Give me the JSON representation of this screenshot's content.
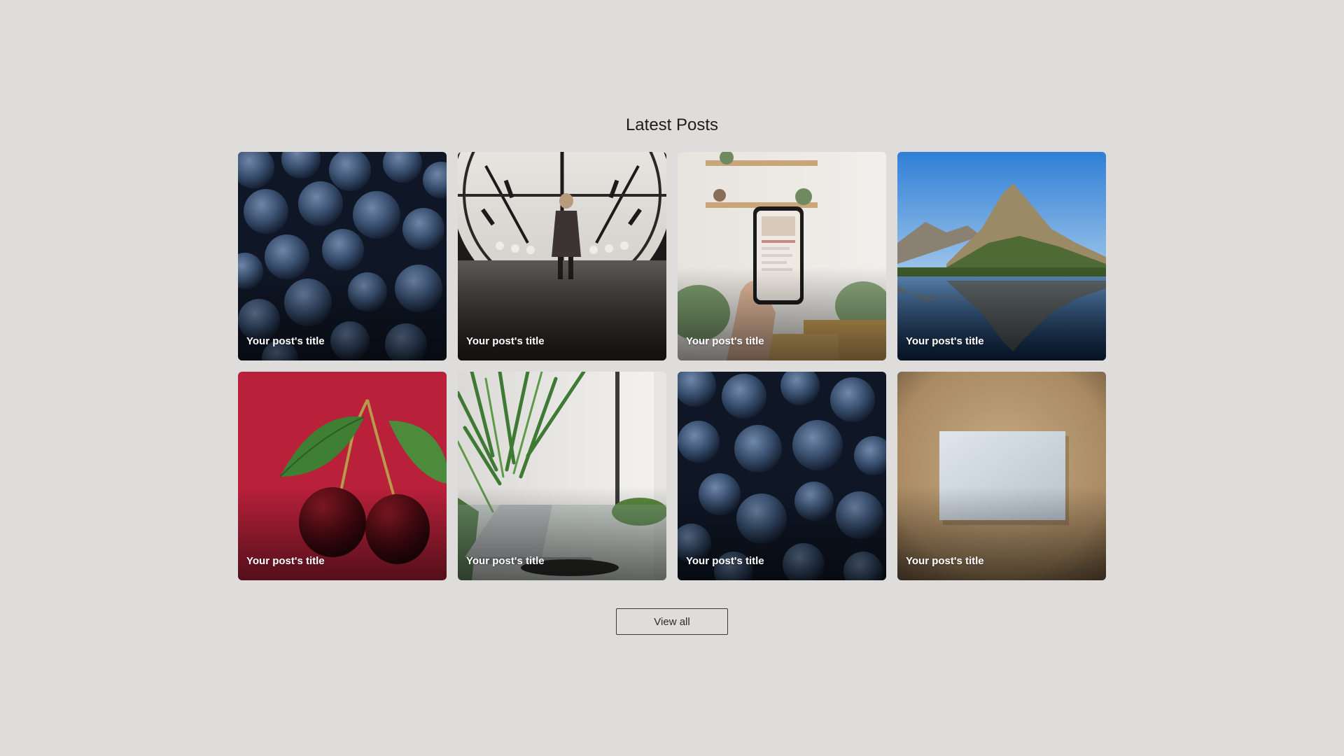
{
  "section": {
    "title": "Latest Posts"
  },
  "posts": [
    {
      "title": "Your post's title",
      "image": "blueberries"
    },
    {
      "title": "Your post's title",
      "image": "clock-window-child"
    },
    {
      "title": "Your post's title",
      "image": "hand-holding-phone"
    },
    {
      "title": "Your post's title",
      "image": "mountain-lake-reflection"
    },
    {
      "title": "Your post's title",
      "image": "cherries-on-red"
    },
    {
      "title": "Your post's title",
      "image": "laptop-with-palm"
    },
    {
      "title": "Your post's title",
      "image": "blueberries"
    },
    {
      "title": "Your post's title",
      "image": "blank-card-on-kraft-paper"
    }
  ],
  "view_all": {
    "label": "View all"
  },
  "colors": {
    "background": "#dedddb",
    "title_text": "#1c1c1c",
    "card_text": "#ffffff",
    "button_border": "#3a3a3a"
  }
}
